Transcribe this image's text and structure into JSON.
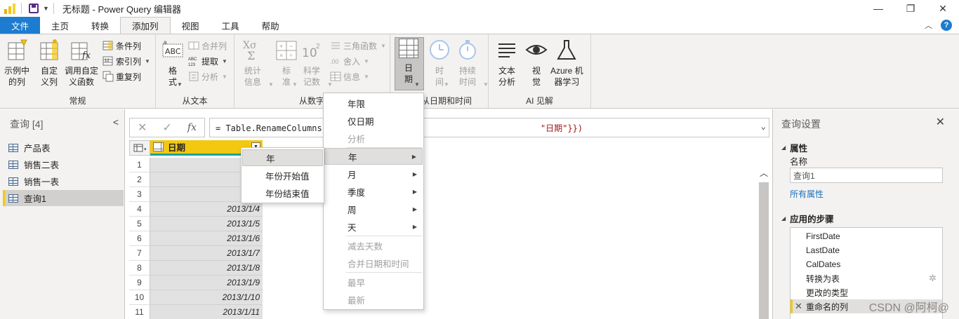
{
  "window": {
    "title": "无标题 - Power Query 编辑器",
    "controls": [
      "—",
      "❐",
      "✕"
    ]
  },
  "tabs": [
    {
      "label": "文件"
    },
    {
      "label": "主页"
    },
    {
      "label": "转换"
    },
    {
      "label": "添加列"
    },
    {
      "label": "视图"
    },
    {
      "label": "工具"
    },
    {
      "label": "帮助"
    }
  ],
  "ribbon": {
    "general": {
      "group_label": "常规",
      "example_col": "示例中\n的列",
      "custom_col": "自定\n义列",
      "invoke_fn": "调用自定\n义函数",
      "conditional_col": "条件列",
      "index_col": "索引列",
      "duplicate_col": "重复列"
    },
    "from_text": {
      "group_label": "从文本",
      "format": "格\n式",
      "merge_cols": "合并列",
      "extract": "提取",
      "parse": "分析"
    },
    "from_number": {
      "group_label": "从数字",
      "statistics": "统计\n信息",
      "standard": "标\n准",
      "scientific": "科学\n记数",
      "trig": "三角函数",
      "rounding": "舍入",
      "info": "信息"
    },
    "from_datetime": {
      "group_label": "从日期和时间",
      "date": "日\n期",
      "time": "时\n间",
      "duration": "持续\n时间"
    },
    "ai": {
      "group_label": "AI 见解",
      "text_analytics": "文本\n分析",
      "vision": "视\n觉",
      "azure_ml": "Azure 机\n器学习"
    }
  },
  "queries_pane": {
    "title": "查询 [4]",
    "items": [
      {
        "label": "产品表"
      },
      {
        "label": "销售二表"
      },
      {
        "label": "销售一表"
      },
      {
        "label": "查询1"
      }
    ]
  },
  "formula_bar": {
    "cancel": "✕",
    "confirm": "✓",
    "fx": "fx",
    "formula_prefix": "= Table.RenameColumns(更",
    "formula_suffix": "\"日期\"}})"
  },
  "grid": {
    "column_header": "日期",
    "rows": [
      {
        "n": "1",
        "v": "2013"
      },
      {
        "n": "2",
        "v": "2013"
      },
      {
        "n": "3",
        "v": "2013"
      },
      {
        "n": "4",
        "v": "2013/1/4"
      },
      {
        "n": "5",
        "v": "2013/1/5"
      },
      {
        "n": "6",
        "v": "2013/1/6"
      },
      {
        "n": "7",
        "v": "2013/1/7"
      },
      {
        "n": "8",
        "v": "2013/1/8"
      },
      {
        "n": "9",
        "v": "2013/1/9"
      },
      {
        "n": "10",
        "v": "2013/1/10"
      },
      {
        "n": "11",
        "v": "2013/1/11"
      }
    ]
  },
  "date_menu": {
    "items": [
      {
        "label": "年限"
      },
      {
        "label": "仅日期"
      },
      {
        "label": "分析"
      },
      {
        "label": "年"
      },
      {
        "label": "月"
      },
      {
        "label": "季度"
      },
      {
        "label": "周"
      },
      {
        "label": "天"
      },
      {
        "label": "减去天数"
      },
      {
        "label": "合并日期和时间"
      },
      {
        "label": "最早"
      },
      {
        "label": "最新"
      }
    ]
  },
  "year_submenu": {
    "items": [
      {
        "label": "年"
      },
      {
        "label": "年份开始值"
      },
      {
        "label": "年份结束值"
      }
    ]
  },
  "settings_pane": {
    "title": "查询设置",
    "properties_header": "属性",
    "name_label": "名称",
    "name_value": "查询1",
    "all_properties": "所有属性",
    "steps_header": "应用的步骤",
    "steps": [
      {
        "label": "FirstDate"
      },
      {
        "label": "LastDate"
      },
      {
        "label": "CalDates"
      },
      {
        "label": "转换为表"
      },
      {
        "label": "更改的类型"
      },
      {
        "label": "重命名的列"
      }
    ]
  },
  "watermark": "CSDN @阿柯@",
  "colors": {
    "accent_blue": "#1d7cd0",
    "column_header_yellow": "#f2c811",
    "header_underline_teal": "#1aa39a"
  }
}
